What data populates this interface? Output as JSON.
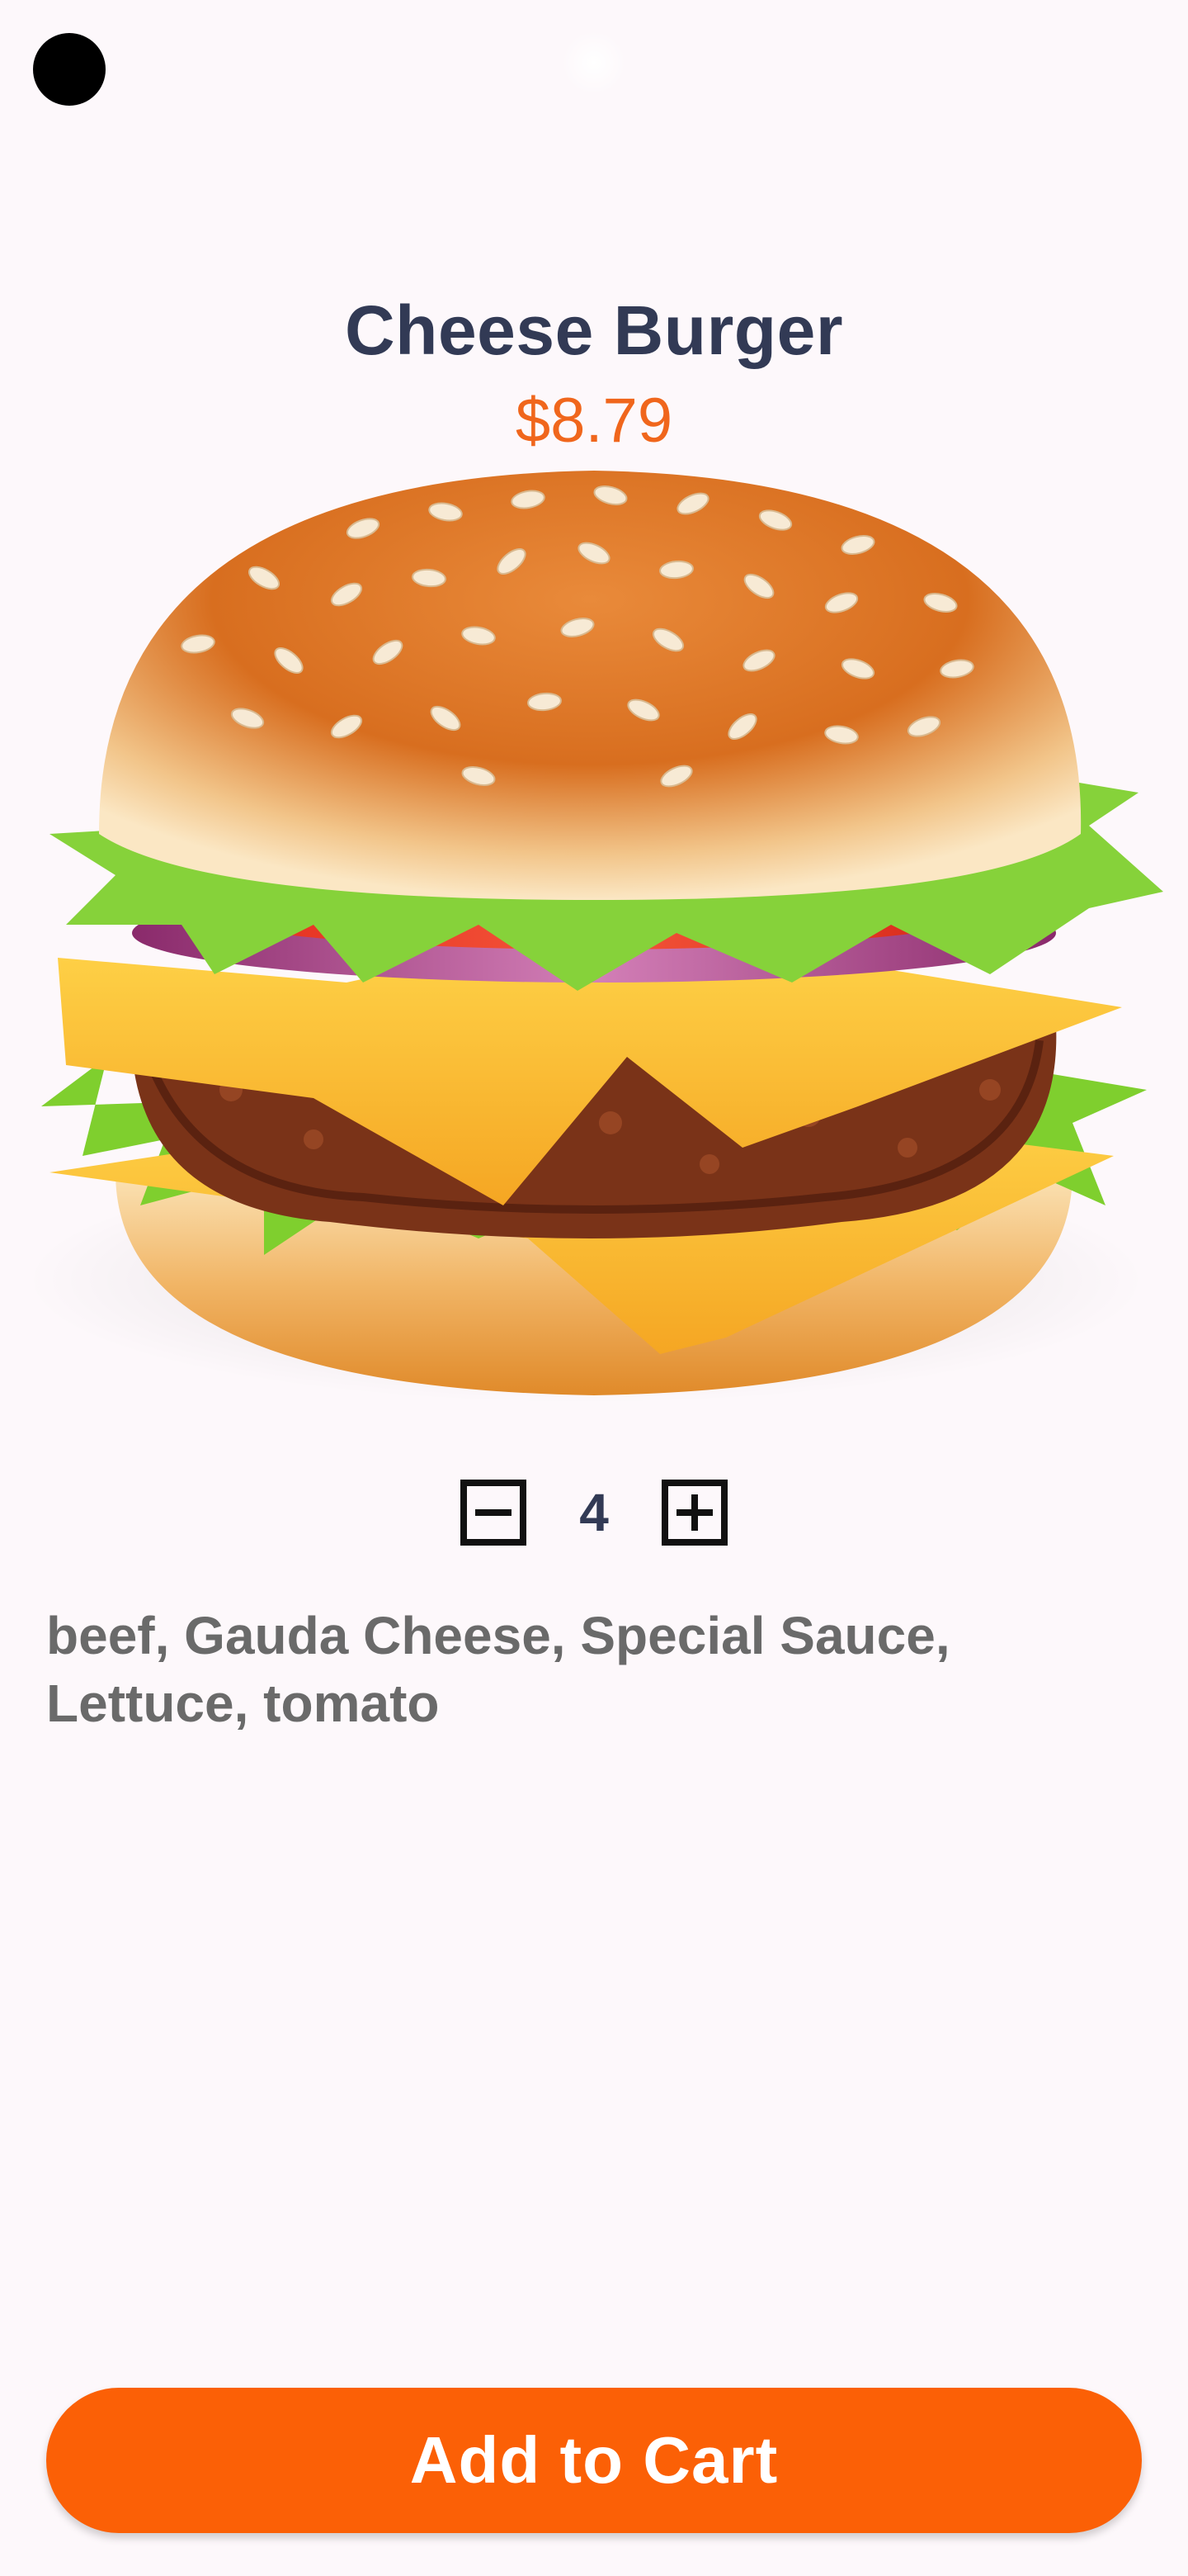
{
  "product": {
    "name": "Cheese Burger",
    "price": "$8.79",
    "image_icon": "cheeseburger-illustration",
    "description": "beef, Gauda Cheese, Special Sauce, Lettuce, tomato"
  },
  "quantity": {
    "value": "4",
    "decrease_icon": "minus-square-icon",
    "increase_icon": "plus-square-icon"
  },
  "actions": {
    "add_to_cart_label": "Add to Cart"
  },
  "colors": {
    "accent": "#fb6006",
    "price": "#f0661c",
    "title": "#323a55",
    "description": "#6a6a6a",
    "background": "#fdf8fb"
  }
}
